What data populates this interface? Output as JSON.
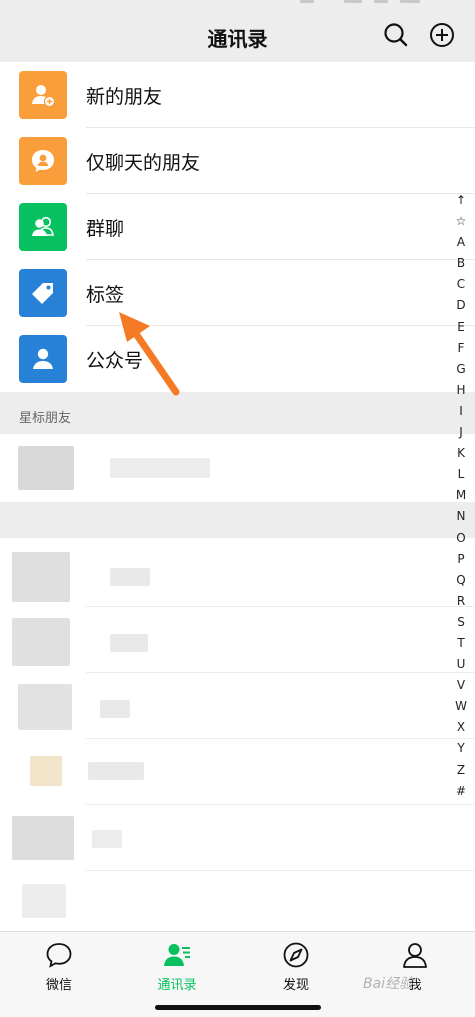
{
  "header": {
    "title": "通讯录",
    "search_icon": "search-icon",
    "add_icon": "add-circle-icon"
  },
  "entries": [
    {
      "label": "新的朋友",
      "color": "#fa9d3b",
      "icon": "add-friend-icon"
    },
    {
      "label": "仅聊天的朋友",
      "color": "#fa9d3b",
      "icon": "chat-only-friend-icon"
    },
    {
      "label": "群聊",
      "color": "#07c160",
      "icon": "group-chat-icon"
    },
    {
      "label": "标签",
      "color": "#2782d7",
      "icon": "tag-icon"
    },
    {
      "label": "公众号",
      "color": "#2782d7",
      "icon": "official-account-icon"
    }
  ],
  "starred_section": {
    "label": "星标朋友"
  },
  "index_letters": [
    "↑",
    "☆",
    "A",
    "B",
    "C",
    "D",
    "E",
    "F",
    "G",
    "H",
    "I",
    "J",
    "K",
    "L",
    "M",
    "N",
    "O",
    "P",
    "Q",
    "R",
    "S",
    "T",
    "U",
    "V",
    "W",
    "X",
    "Y",
    "Z",
    "#"
  ],
  "tabs": [
    {
      "label": "微信",
      "icon": "chat-bubble-icon",
      "active": false
    },
    {
      "label": "通讯录",
      "icon": "contacts-icon",
      "active": true
    },
    {
      "label": "发现",
      "icon": "compass-icon",
      "active": false
    },
    {
      "label": "我",
      "icon": "person-icon",
      "active": false
    }
  ],
  "watermark": "Bai经验",
  "colors": {
    "accent": "#07c160",
    "arrow": "#f47a26",
    "background": "#ededed"
  }
}
